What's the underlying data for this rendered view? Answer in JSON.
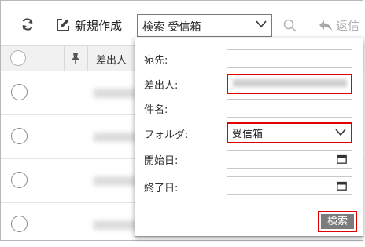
{
  "toolbar": {
    "new_label": "新規作成",
    "search_folder_value": "検索 受信箱",
    "reply_label": "返信"
  },
  "list_header": {
    "sender_label": "差出人"
  },
  "search_form": {
    "recipient_label": "宛先:",
    "sender_label": "差出人:",
    "subject_label": "件名:",
    "folder_label": "フォルダ:",
    "folder_value": "受信箱",
    "start_date_label": "開始日:",
    "end_date_label": "終了日:",
    "search_button": "検索"
  },
  "colors": {
    "highlight": "#e00000",
    "button_bg": "#7b7b7b"
  }
}
